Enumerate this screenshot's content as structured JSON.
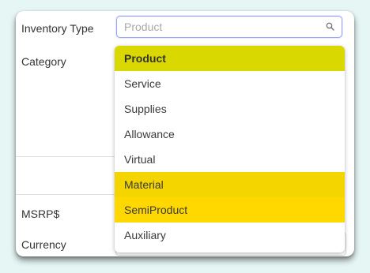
{
  "form": {
    "inventory_type_label": "Inventory Type",
    "category_label": "Category",
    "msrp_label": "MSRP$",
    "currency_label": "Currency"
  },
  "search": {
    "placeholder": "Product",
    "value": ""
  },
  "dropdown": {
    "options": [
      {
        "label": "Product",
        "highlight": "#d9d800",
        "selected": true
      },
      {
        "label": "Service",
        "highlight": null,
        "selected": false
      },
      {
        "label": "Supplies",
        "highlight": null,
        "selected": false
      },
      {
        "label": "Allowance",
        "highlight": null,
        "selected": false
      },
      {
        "label": "Virtual",
        "highlight": null,
        "selected": false
      },
      {
        "label": "Material",
        "highlight": "#f4d500",
        "selected": false
      },
      {
        "label": "SemiProduct",
        "highlight": "#ffd800",
        "selected": false
      },
      {
        "label": "Auxiliary",
        "highlight": null,
        "selected": false
      }
    ]
  },
  "colors": {
    "background": "#e6f6f4",
    "focus_border": "#9aa3ff"
  },
  "icons": {
    "search": "search-icon"
  }
}
